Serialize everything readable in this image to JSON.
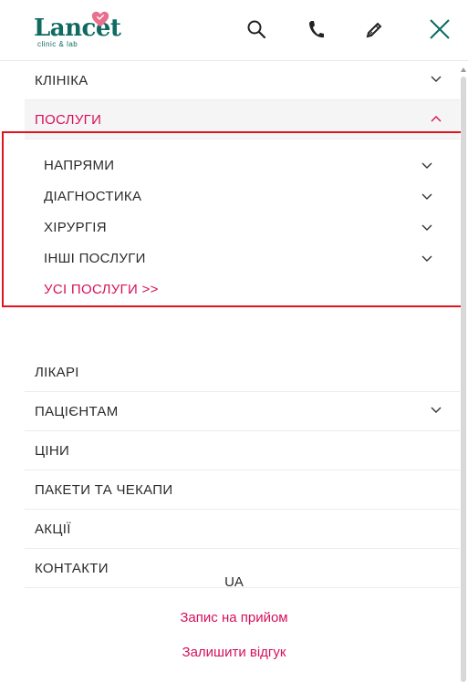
{
  "brand": {
    "name": "Lancet",
    "tagline": "clinic & lab"
  },
  "header": {
    "icons": [
      "search-icon",
      "phone-icon",
      "pencil-icon",
      "close-icon"
    ]
  },
  "menu": {
    "items": [
      {
        "label": "КЛІНІКА",
        "has_children": true
      },
      {
        "label": "ПОСЛУГИ",
        "has_children": true,
        "expanded": true
      },
      {
        "label": "ЛІКАРІ",
        "has_children": false
      },
      {
        "label": "ПАЦІЄНТАМ",
        "has_children": true
      },
      {
        "label": "ЦІНИ",
        "has_children": false
      },
      {
        "label": "ПАКЕТИ ТА ЧЕКАПИ",
        "has_children": false
      },
      {
        "label": "АКЦІЇ",
        "has_children": false
      },
      {
        "label": "КОНТАКТИ",
        "has_children": false
      }
    ],
    "services_sub": [
      {
        "label": "НАПРЯМИ"
      },
      {
        "label": "ДІАГНОСТИКА"
      },
      {
        "label": "ХІРУРГІЯ"
      },
      {
        "label": "ІНШІ ПОСЛУГИ"
      }
    ],
    "services_all": "УСІ ПОСЛУГИ >>"
  },
  "footer": {
    "language": "UA",
    "appointment": "Запис на прийом",
    "review": "Залишити відгук"
  },
  "colors": {
    "brand_teal": "#0f6b61",
    "accent": "#d6105b",
    "highlight": "#e0141e"
  }
}
